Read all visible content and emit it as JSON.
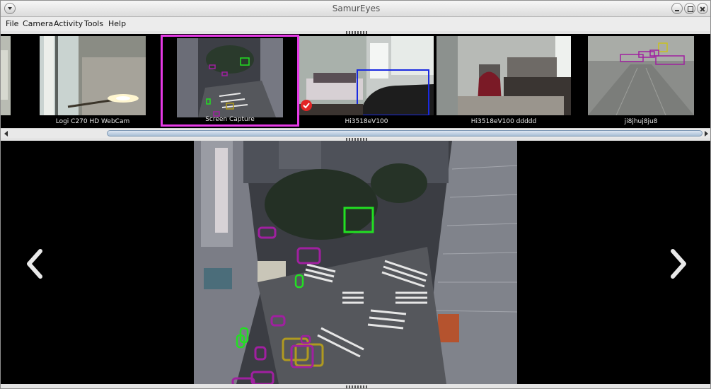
{
  "window": {
    "title": "SamurEyes"
  },
  "menu": {
    "items": [
      "File",
      "Camera",
      "Activity",
      "Tools",
      "Help"
    ]
  },
  "cameras": [
    {
      "label": "Logi C270 HD WebCam"
    },
    {
      "label": "Screen Capture",
      "selected": true
    },
    {
      "label": "Hi3518eV100",
      "recording": true
    },
    {
      "label": "Hi3518eV100 ddddd"
    },
    {
      "label": "ji8jhuj8ju8"
    }
  ],
  "main_view": {
    "camera": "Screen Capture"
  },
  "colors": {
    "selected_border": "#e63ae6",
    "detect_green": "#22e022",
    "detect_purple": "#a020a0",
    "detect_olive": "#b09a20",
    "detect_blue": "#1a2ae0"
  },
  "icons": [
    "window-menu-icon",
    "minimize-icon",
    "maximize-icon",
    "close-icon",
    "prev-arrow-icon",
    "next-arrow-icon",
    "recording-check-icon"
  ]
}
